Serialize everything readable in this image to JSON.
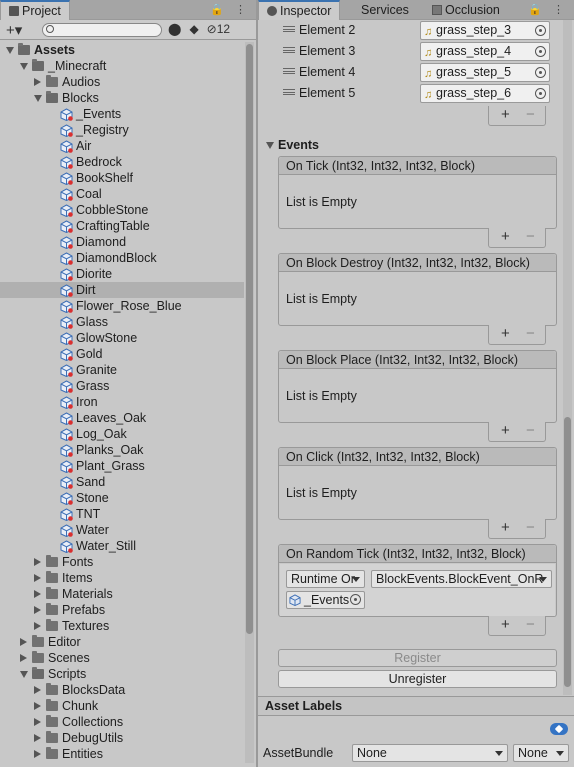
{
  "project": {
    "tab": "Project",
    "hidden_count": "12",
    "tree": [
      {
        "label": "Assets",
        "depth": 0,
        "kind": "folder",
        "state": "open",
        "bold": true
      },
      {
        "label": "_Minecraft",
        "depth": 1,
        "kind": "folder",
        "state": "open"
      },
      {
        "label": "Audios",
        "depth": 2,
        "kind": "folder",
        "state": "closed"
      },
      {
        "label": "Blocks",
        "depth": 2,
        "kind": "folder",
        "state": "open"
      },
      {
        "label": "_Events",
        "depth": 3,
        "kind": "asset"
      },
      {
        "label": "_Registry",
        "depth": 3,
        "kind": "asset"
      },
      {
        "label": "Air",
        "depth": 3,
        "kind": "asset"
      },
      {
        "label": "Bedrock",
        "depth": 3,
        "kind": "asset"
      },
      {
        "label": "BookShelf",
        "depth": 3,
        "kind": "asset"
      },
      {
        "label": "Coal",
        "depth": 3,
        "kind": "asset"
      },
      {
        "label": "CobbleStone",
        "depth": 3,
        "kind": "asset"
      },
      {
        "label": "CraftingTable",
        "depth": 3,
        "kind": "asset"
      },
      {
        "label": "Diamond",
        "depth": 3,
        "kind": "asset"
      },
      {
        "label": "DiamondBlock",
        "depth": 3,
        "kind": "asset"
      },
      {
        "label": "Diorite",
        "depth": 3,
        "kind": "asset"
      },
      {
        "label": "Dirt",
        "depth": 3,
        "kind": "asset",
        "selected": true
      },
      {
        "label": "Flower_Rose_Blue",
        "depth": 3,
        "kind": "asset"
      },
      {
        "label": "Glass",
        "depth": 3,
        "kind": "asset"
      },
      {
        "label": "GlowStone",
        "depth": 3,
        "kind": "asset"
      },
      {
        "label": "Gold",
        "depth": 3,
        "kind": "asset"
      },
      {
        "label": "Granite",
        "depth": 3,
        "kind": "asset"
      },
      {
        "label": "Grass",
        "depth": 3,
        "kind": "asset"
      },
      {
        "label": "Iron",
        "depth": 3,
        "kind": "asset"
      },
      {
        "label": "Leaves_Oak",
        "depth": 3,
        "kind": "asset"
      },
      {
        "label": "Log_Oak",
        "depth": 3,
        "kind": "asset"
      },
      {
        "label": "Planks_Oak",
        "depth": 3,
        "kind": "asset"
      },
      {
        "label": "Plant_Grass",
        "depth": 3,
        "kind": "asset"
      },
      {
        "label": "Sand",
        "depth": 3,
        "kind": "asset"
      },
      {
        "label": "Stone",
        "depth": 3,
        "kind": "asset"
      },
      {
        "label": "TNT",
        "depth": 3,
        "kind": "asset"
      },
      {
        "label": "Water",
        "depth": 3,
        "kind": "asset"
      },
      {
        "label": "Water_Still",
        "depth": 3,
        "kind": "asset"
      },
      {
        "label": "Fonts",
        "depth": 2,
        "kind": "folder",
        "state": "closed"
      },
      {
        "label": "Items",
        "depth": 2,
        "kind": "folder",
        "state": "closed"
      },
      {
        "label": "Materials",
        "depth": 2,
        "kind": "folder",
        "state": "closed"
      },
      {
        "label": "Prefabs",
        "depth": 2,
        "kind": "folder",
        "state": "closed"
      },
      {
        "label": "Textures",
        "depth": 2,
        "kind": "folder",
        "state": "closed"
      },
      {
        "label": "Editor",
        "depth": 1,
        "kind": "folder",
        "state": "closed"
      },
      {
        "label": "Scenes",
        "depth": 1,
        "kind": "folder",
        "state": "closed"
      },
      {
        "label": "Scripts",
        "depth": 1,
        "kind": "folder",
        "state": "open"
      },
      {
        "label": "BlocksData",
        "depth": 2,
        "kind": "folder",
        "state": "closed"
      },
      {
        "label": "Chunk",
        "depth": 2,
        "kind": "folder",
        "state": "closed"
      },
      {
        "label": "Collections",
        "depth": 2,
        "kind": "folder",
        "state": "closed"
      },
      {
        "label": "DebugUtils",
        "depth": 2,
        "kind": "folder",
        "state": "closed"
      },
      {
        "label": "Entities",
        "depth": 2,
        "kind": "folder",
        "state": "closed"
      }
    ]
  },
  "inspector": {
    "tabs": [
      "Inspector",
      "Services",
      "Occlusion"
    ],
    "elements": [
      {
        "label": "Element 2",
        "value": "grass_step_3"
      },
      {
        "label": "Element 3",
        "value": "grass_step_4"
      },
      {
        "label": "Element 4",
        "value": "grass_step_5"
      },
      {
        "label": "Element 5",
        "value": "grass_step_6"
      }
    ],
    "events_title": "Events",
    "events": [
      {
        "title": "On Tick (Int32, Int32, Int32, Block)",
        "body": "List is Empty"
      },
      {
        "title": "On Block Destroy (Int32, Int32, Int32, Block)",
        "body": "List is Empty"
      },
      {
        "title": "On Block Place (Int32, Int32, Int32, Block)",
        "body": "List is Empty"
      },
      {
        "title": "On Click (Int32, Int32, Int32, Block)",
        "body": "List is Empty"
      }
    ],
    "random_tick": {
      "title": "On Random Tick (Int32, Int32, Int32, Block)",
      "runtime": "Runtime Or",
      "function": "BlockEvents.BlockEvent_OnR",
      "object": "_Events"
    },
    "register_label": "Register",
    "unregister_label": "Unregister",
    "asset_labels": "Asset Labels",
    "asset_bundle_label": "AssetBundle",
    "asset_bundle_value": "None",
    "asset_variant_value": "None"
  }
}
